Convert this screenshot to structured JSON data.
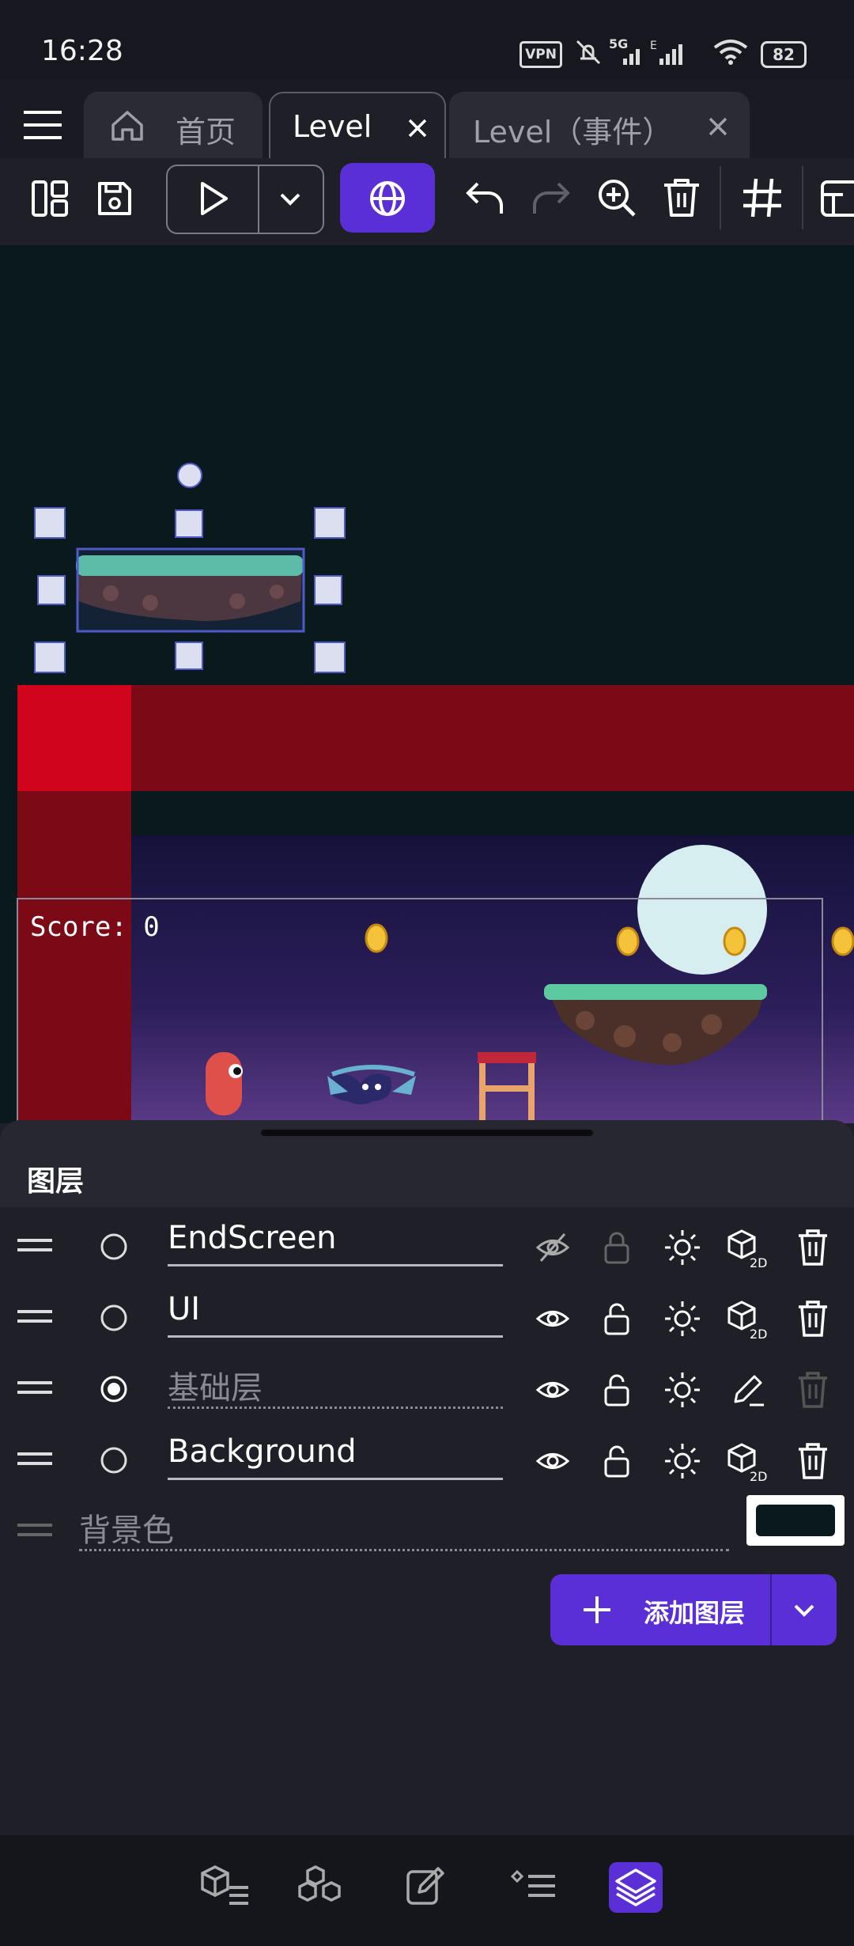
{
  "status_bar": {
    "time": "16:28",
    "vpn_label": "VPN",
    "network_label": "5G",
    "battery_level": "82"
  },
  "tabs": [
    {
      "label": "首页",
      "icon": "home-icon"
    },
    {
      "label": "Level",
      "active": true
    },
    {
      "label": "Level（事件）"
    }
  ],
  "toolbar": {
    "icons": [
      "layout-icon",
      "save-icon",
      "play-icon",
      "chevron-down-icon",
      "globe-icon",
      "undo-icon",
      "redo-icon",
      "zoom-in-icon",
      "trash-icon",
      "grid-icon",
      "layers-edit-icon"
    ],
    "accent": "#5b2fd6"
  },
  "scene": {
    "score_text": "Score: 0"
  },
  "layers_panel": {
    "title": "图层",
    "layers": [
      {
        "name": "EndScreen",
        "selected": false,
        "visible": false
      },
      {
        "name": "UI",
        "selected": false,
        "visible": true
      },
      {
        "name": "基础层",
        "selected": true,
        "visible": true,
        "placeholder": true
      },
      {
        "name": "Background",
        "selected": false,
        "visible": true
      }
    ],
    "background_color_label": "背景色",
    "background_color": "#0a1a1c",
    "add_layer_label": "添加图层"
  },
  "bottom_nav": {
    "items": [
      "objects-list-icon",
      "object-groups-icon",
      "properties-icon",
      "instances-list-icon",
      "layers-icon"
    ],
    "active": "layers-icon"
  }
}
